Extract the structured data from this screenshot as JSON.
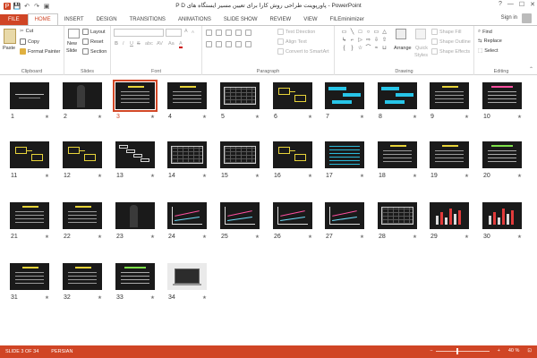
{
  "window": {
    "title": "P D پاورپوینت طراحی روش کارا برای تعیین مسیر ایستگاه های - PowerPoint",
    "controls": [
      "?",
      "—",
      "☐",
      "✕"
    ]
  },
  "qat": [
    "💾",
    "↶",
    "↷",
    "▣"
  ],
  "tabs": [
    {
      "label": "FILE",
      "kind": "file"
    },
    {
      "label": "HOME",
      "kind": "active"
    },
    {
      "label": "INSERT"
    },
    {
      "label": "DESIGN"
    },
    {
      "label": "TRANSITIONS"
    },
    {
      "label": "ANIMATIONS"
    },
    {
      "label": "SLIDE SHOW"
    },
    {
      "label": "REVIEW"
    },
    {
      "label": "VIEW"
    },
    {
      "label": "FILEminimizer"
    }
  ],
  "signin": "Sign in",
  "ribbon": {
    "clipboard": {
      "paste": "Paste",
      "cut": "Cut",
      "copy": "Copy",
      "format_painter": "Format Painter",
      "label": "Clipboard"
    },
    "slides": {
      "new_slide_1": "New",
      "new_slide_2": "Slide",
      "layout": "Layout",
      "reset": "Reset",
      "section": "Section",
      "label": "Slides"
    },
    "font": {
      "bold": "B",
      "italic": "I",
      "underline": "U",
      "strike": "S",
      "shadow": "abc",
      "spacing": "AV",
      "case": "Aa",
      "color": "A",
      "grow": "A",
      "shrink": "A",
      "label": "Font"
    },
    "paragraph": {
      "text_direction": "Text Direction",
      "align_text": "Align Text",
      "smartart": "Convert to SmartArt",
      "label": "Paragraph"
    },
    "drawing": {
      "arrange": "Arrange",
      "quick_styles_1": "Quick",
      "quick_styles_2": "Styles",
      "shape_fill": "Shape Fill",
      "shape_outline": "Shape Outline",
      "shape_effects": "Shape Effects",
      "label": "Drawing",
      "shapes": [
        "▭",
        "╲",
        "□",
        "○",
        "▭",
        "△",
        "↳",
        "⌐",
        "▷",
        "⇨",
        "⇩",
        "⇧",
        "{",
        "}",
        "☆",
        "⌒",
        "≈",
        "⊔"
      ]
    },
    "editing": {
      "find": "Find",
      "replace": "Replace",
      "select": "Select",
      "label": "Editing"
    }
  },
  "slides": [
    {
      "n": "1",
      "type": "title"
    },
    {
      "n": "2",
      "type": "person"
    },
    {
      "n": "3",
      "type": "text",
      "selected": true
    },
    {
      "n": "4",
      "type": "text"
    },
    {
      "n": "5",
      "type": "table"
    },
    {
      "n": "6",
      "type": "yellowbox"
    },
    {
      "n": "7",
      "type": "cyan"
    },
    {
      "n": "8",
      "type": "cyan"
    },
    {
      "n": "9",
      "type": "text"
    },
    {
      "n": "10",
      "type": "pinktext"
    },
    {
      "n": "11",
      "type": "yellowbox"
    },
    {
      "n": "12",
      "type": "yellowbox"
    },
    {
      "n": "13",
      "type": "steps"
    },
    {
      "n": "14",
      "type": "grid"
    },
    {
      "n": "15",
      "type": "table"
    },
    {
      "n": "16",
      "type": "yellowbox"
    },
    {
      "n": "17",
      "type": "cyanlines"
    },
    {
      "n": "18",
      "type": "text"
    },
    {
      "n": "19",
      "type": "text"
    },
    {
      "n": "20",
      "type": "greentext"
    },
    {
      "n": "21",
      "type": "text"
    },
    {
      "n": "22",
      "type": "text"
    },
    {
      "n": "23",
      "type": "person"
    },
    {
      "n": "24",
      "type": "chart"
    },
    {
      "n": "25",
      "type": "chart"
    },
    {
      "n": "26",
      "type": "chart"
    },
    {
      "n": "27",
      "type": "chart"
    },
    {
      "n": "28",
      "type": "grid"
    },
    {
      "n": "29",
      "type": "bars"
    },
    {
      "n": "30",
      "type": "bars"
    },
    {
      "n": "31",
      "type": "text"
    },
    {
      "n": "32",
      "type": "text"
    },
    {
      "n": "33",
      "type": "greentext"
    },
    {
      "n": "34",
      "type": "photo"
    }
  ],
  "status": {
    "slide": "SLIDE 3 OF 34",
    "language": "PERSIAN",
    "zoom": "40 %",
    "zoom_level": 40
  }
}
